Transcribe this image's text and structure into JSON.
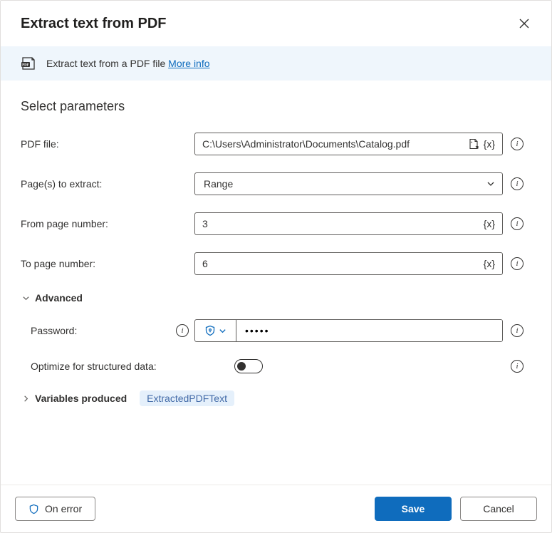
{
  "header": {
    "title": "Extract text from PDF"
  },
  "info": {
    "text": "Extract text from a PDF file",
    "link_text": "More info"
  },
  "section_title": "Select parameters",
  "fields": {
    "pdf_file": {
      "label": "PDF file:",
      "value": "C:\\Users\\Administrator\\Documents\\Catalog.pdf"
    },
    "pages_to_extract": {
      "label": "Page(s) to extract:",
      "value": "Range"
    },
    "from_page": {
      "label": "From page number:",
      "value": "3"
    },
    "to_page": {
      "label": "To page number:",
      "value": "6"
    }
  },
  "advanced": {
    "label": "Advanced",
    "password": {
      "label": "Password:",
      "value": "•••••"
    },
    "optimize": {
      "label": "Optimize for structured data:",
      "value": false
    }
  },
  "variables": {
    "label": "Variables produced",
    "badge": "ExtractedPDFText"
  },
  "footer": {
    "on_error": "On error",
    "save": "Save",
    "cancel": "Cancel"
  },
  "glyphs": {
    "var_token": "{x}"
  }
}
